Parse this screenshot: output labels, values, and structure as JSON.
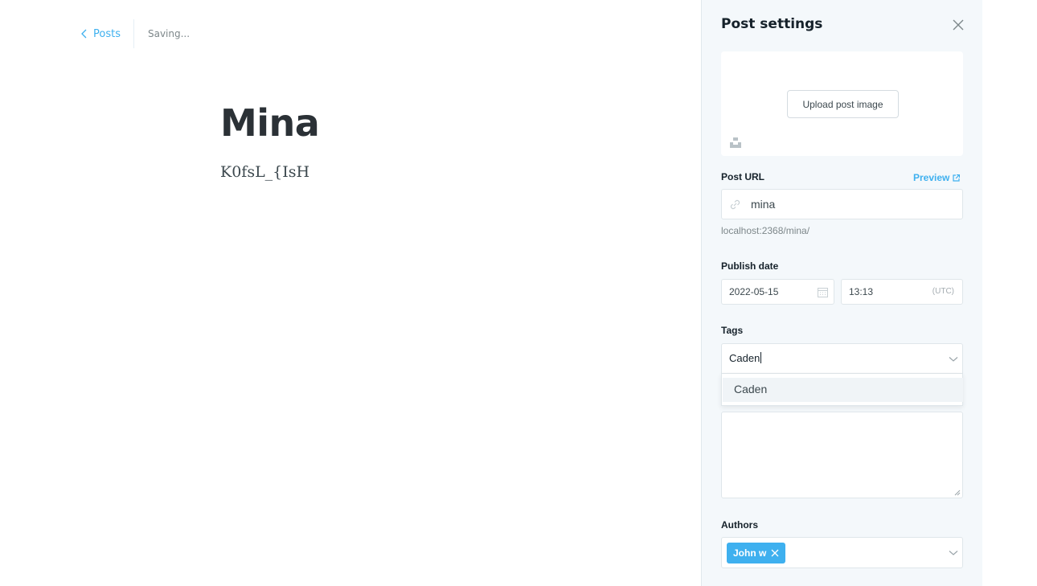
{
  "header": {
    "back_label": "Posts",
    "status": "Saving..."
  },
  "post": {
    "title": "Mina",
    "body": "K0fsL_{IsH"
  },
  "settings": {
    "title": "Post settings",
    "upload_label": "Upload post image",
    "url_label": "Post URL",
    "preview_label": "Preview",
    "url_value": "mina",
    "url_hint": "localhost:2368/mina/",
    "publish_label": "Publish date",
    "date_value": "2022-05-15",
    "time_value": "13:13",
    "timezone": "(UTC)",
    "tags_label": "Tags",
    "tags_input": "Caden",
    "tag_option": "Caden",
    "authors_label": "Authors",
    "author_chip": "John w"
  },
  "colors": {
    "accent": "#3eb0ef",
    "panel_bg": "#f4f8fb",
    "title_text": "#2b3136"
  },
  "icons": [
    "chevron-left-icon",
    "close-icon",
    "unsplash-icon",
    "link-icon",
    "external-link-icon",
    "calendar-icon",
    "chevron-down-icon",
    "remove-x-icon"
  ]
}
